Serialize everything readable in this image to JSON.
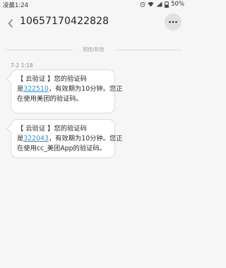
{
  "status_bar": {
    "time": "凌晨1:24",
    "battery": "50%",
    "icons": [
      "alarm-icon",
      "wifi-icon",
      "signal-icon",
      "battery-icon"
    ]
  },
  "header": {
    "contact": "10657170422828",
    "back_icon": "back-chevron-icon",
    "more_icon": "more-icon"
  },
  "divider": {
    "label": "短信/彩信"
  },
  "conversation": {
    "timestamp": "7-2 1:18",
    "messages": [
      {
        "line1": "【 云验证 】您的验证码",
        "line2_prefix": "是",
        "code": "322510",
        "line2_suffix": "，有效期为10分钟。您正",
        "line3": "在使用美团的验证码。"
      },
      {
        "line1": "【 云验证 】您的验证码",
        "line2_prefix": "是",
        "code": "322043",
        "line2_suffix": "，有效期为10分钟。您正",
        "line3": "在使用cc_美团App的验证码。"
      }
    ]
  },
  "colors": {
    "background": "#f6f6f6",
    "bubble": "#ffffff",
    "link": "#2f95d8"
  }
}
